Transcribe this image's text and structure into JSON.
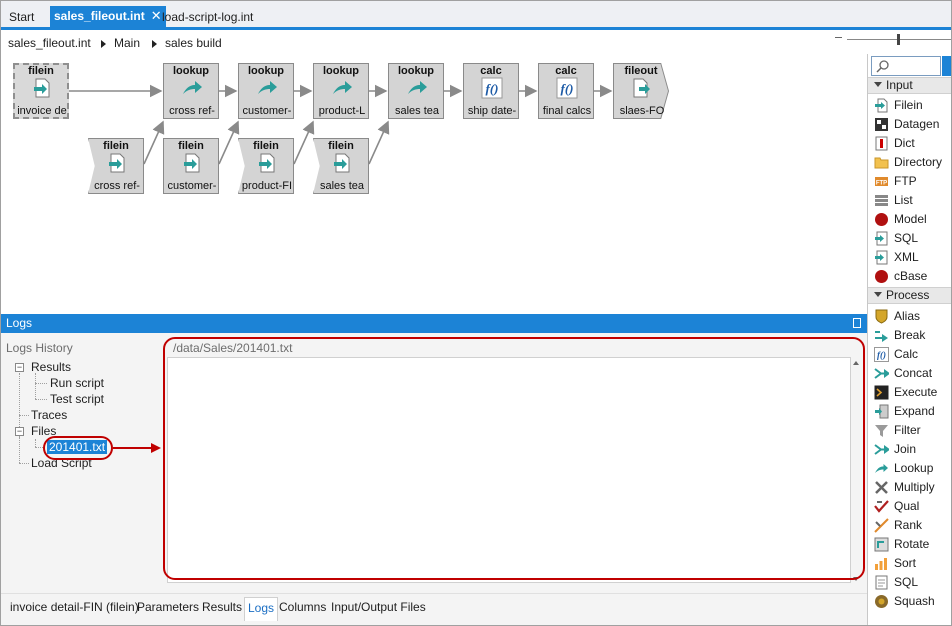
{
  "tabs": [
    {
      "label": "Start"
    },
    {
      "label": "sales_fileout.int",
      "close": "✕"
    },
    {
      "label": "load-script-log.int"
    }
  ],
  "breadcrumb": [
    "sales_fileout.int",
    "Main",
    "sales build"
  ],
  "nodes": {
    "n1": {
      "type": "filein",
      "label": "invoice de"
    },
    "n2": {
      "type": "lookup",
      "label": "cross ref-"
    },
    "n3": {
      "type": "lookup",
      "label": "customer-"
    },
    "n4": {
      "type": "lookup",
      "label": "product-L"
    },
    "n5": {
      "type": "lookup",
      "label": "sales tea"
    },
    "n6": {
      "type": "calc",
      "label": "ship date-"
    },
    "n7": {
      "type": "calc",
      "label": "final calcs"
    },
    "n8": {
      "type": "fileout",
      "label": "slaes-FO"
    },
    "n9": {
      "type": "filein",
      "label": "cross ref-"
    },
    "n10": {
      "type": "filein",
      "label": "customer-"
    },
    "n11": {
      "type": "filein",
      "label": "product-FI"
    },
    "n12": {
      "type": "filein",
      "label": "sales tea"
    }
  },
  "palette": {
    "input_section": "Input",
    "input_items": [
      {
        "label": "Filein",
        "icon": "filein-icon"
      },
      {
        "label": "Datagen",
        "icon": "datagen-icon"
      },
      {
        "label": "Dict",
        "icon": "dict-icon"
      },
      {
        "label": "Directory",
        "icon": "folder-icon"
      },
      {
        "label": "FTP",
        "icon": "ftp-icon"
      },
      {
        "label": "List",
        "icon": "list-icon"
      },
      {
        "label": "Model",
        "icon": "model-icon"
      },
      {
        "label": "SQL",
        "icon": "sql-icon"
      },
      {
        "label": "XML",
        "icon": "xml-icon"
      },
      {
        "label": "cBase",
        "icon": "cbase-icon"
      }
    ],
    "process_section": "Process",
    "process_items": [
      {
        "label": "Alias",
        "icon": "alias-icon"
      },
      {
        "label": "Break",
        "icon": "break-icon"
      },
      {
        "label": "Calc",
        "icon": "calc-icon"
      },
      {
        "label": "Concat",
        "icon": "concat-icon"
      },
      {
        "label": "Execute",
        "icon": "execute-icon"
      },
      {
        "label": "Expand",
        "icon": "expand-icon"
      },
      {
        "label": "Filter",
        "icon": "filter-icon"
      },
      {
        "label": "Join",
        "icon": "join-icon"
      },
      {
        "label": "Lookup",
        "icon": "lookup-icon"
      },
      {
        "label": "Multiply",
        "icon": "multiply-icon"
      },
      {
        "label": "Qual",
        "icon": "qual-icon"
      },
      {
        "label": "Rank",
        "icon": "rank-icon"
      },
      {
        "label": "Rotate",
        "icon": "rotate-icon"
      },
      {
        "label": "Sort",
        "icon": "sort-icon"
      },
      {
        "label": "SQL",
        "icon": "sql-icon"
      },
      {
        "label": "Squash",
        "icon": "squash-icon"
      }
    ]
  },
  "logs": {
    "header": "Logs",
    "history_title": "Logs History",
    "tree": {
      "results": "Results",
      "run_script": "Run script",
      "test_script": "Test script",
      "traces": "Traces",
      "files": "Files",
      "file_selected": "201401.txt",
      "load_script": "Load Script"
    },
    "path": "/data/Sales/201401.txt"
  },
  "bottom_tabs": [
    {
      "label": "invoice detail-FIN (filein)"
    },
    {
      "label": "Parameters"
    },
    {
      "label": "Results"
    },
    {
      "label": "Logs",
      "active": true
    },
    {
      "label": "Columns"
    },
    {
      "label": "Input/Output Files"
    }
  ],
  "colors": {
    "accent": "#1c83d6",
    "annotation": "#c00000",
    "node_fill": "#d4d4d4",
    "teal": "#2a9d9a"
  }
}
